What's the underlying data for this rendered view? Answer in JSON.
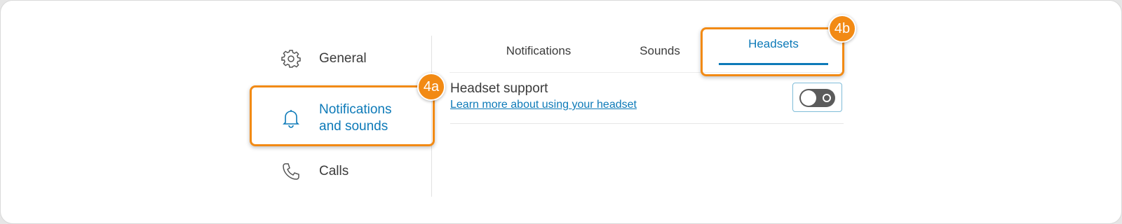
{
  "sidebar": {
    "items": [
      {
        "label": "General",
        "icon": "gear-icon"
      },
      {
        "label": "Notifications and sounds",
        "line1": "Notifications",
        "line2": "and sounds",
        "icon": "bell-icon",
        "active": true
      },
      {
        "label": "Calls",
        "icon": "phone-icon"
      }
    ]
  },
  "tabs": [
    {
      "label": "Notifications"
    },
    {
      "label": "Sounds"
    },
    {
      "label": "Headsets",
      "active": true
    }
  ],
  "headset": {
    "title": "Headset support",
    "link": "Learn more about using your headset",
    "toggle_on": false
  },
  "callouts": {
    "a": "4a",
    "b": "4b"
  },
  "colors": {
    "accent": "#0d7ab8",
    "callout": "#f28a14",
    "toggle_off": "#5b5b5b"
  }
}
